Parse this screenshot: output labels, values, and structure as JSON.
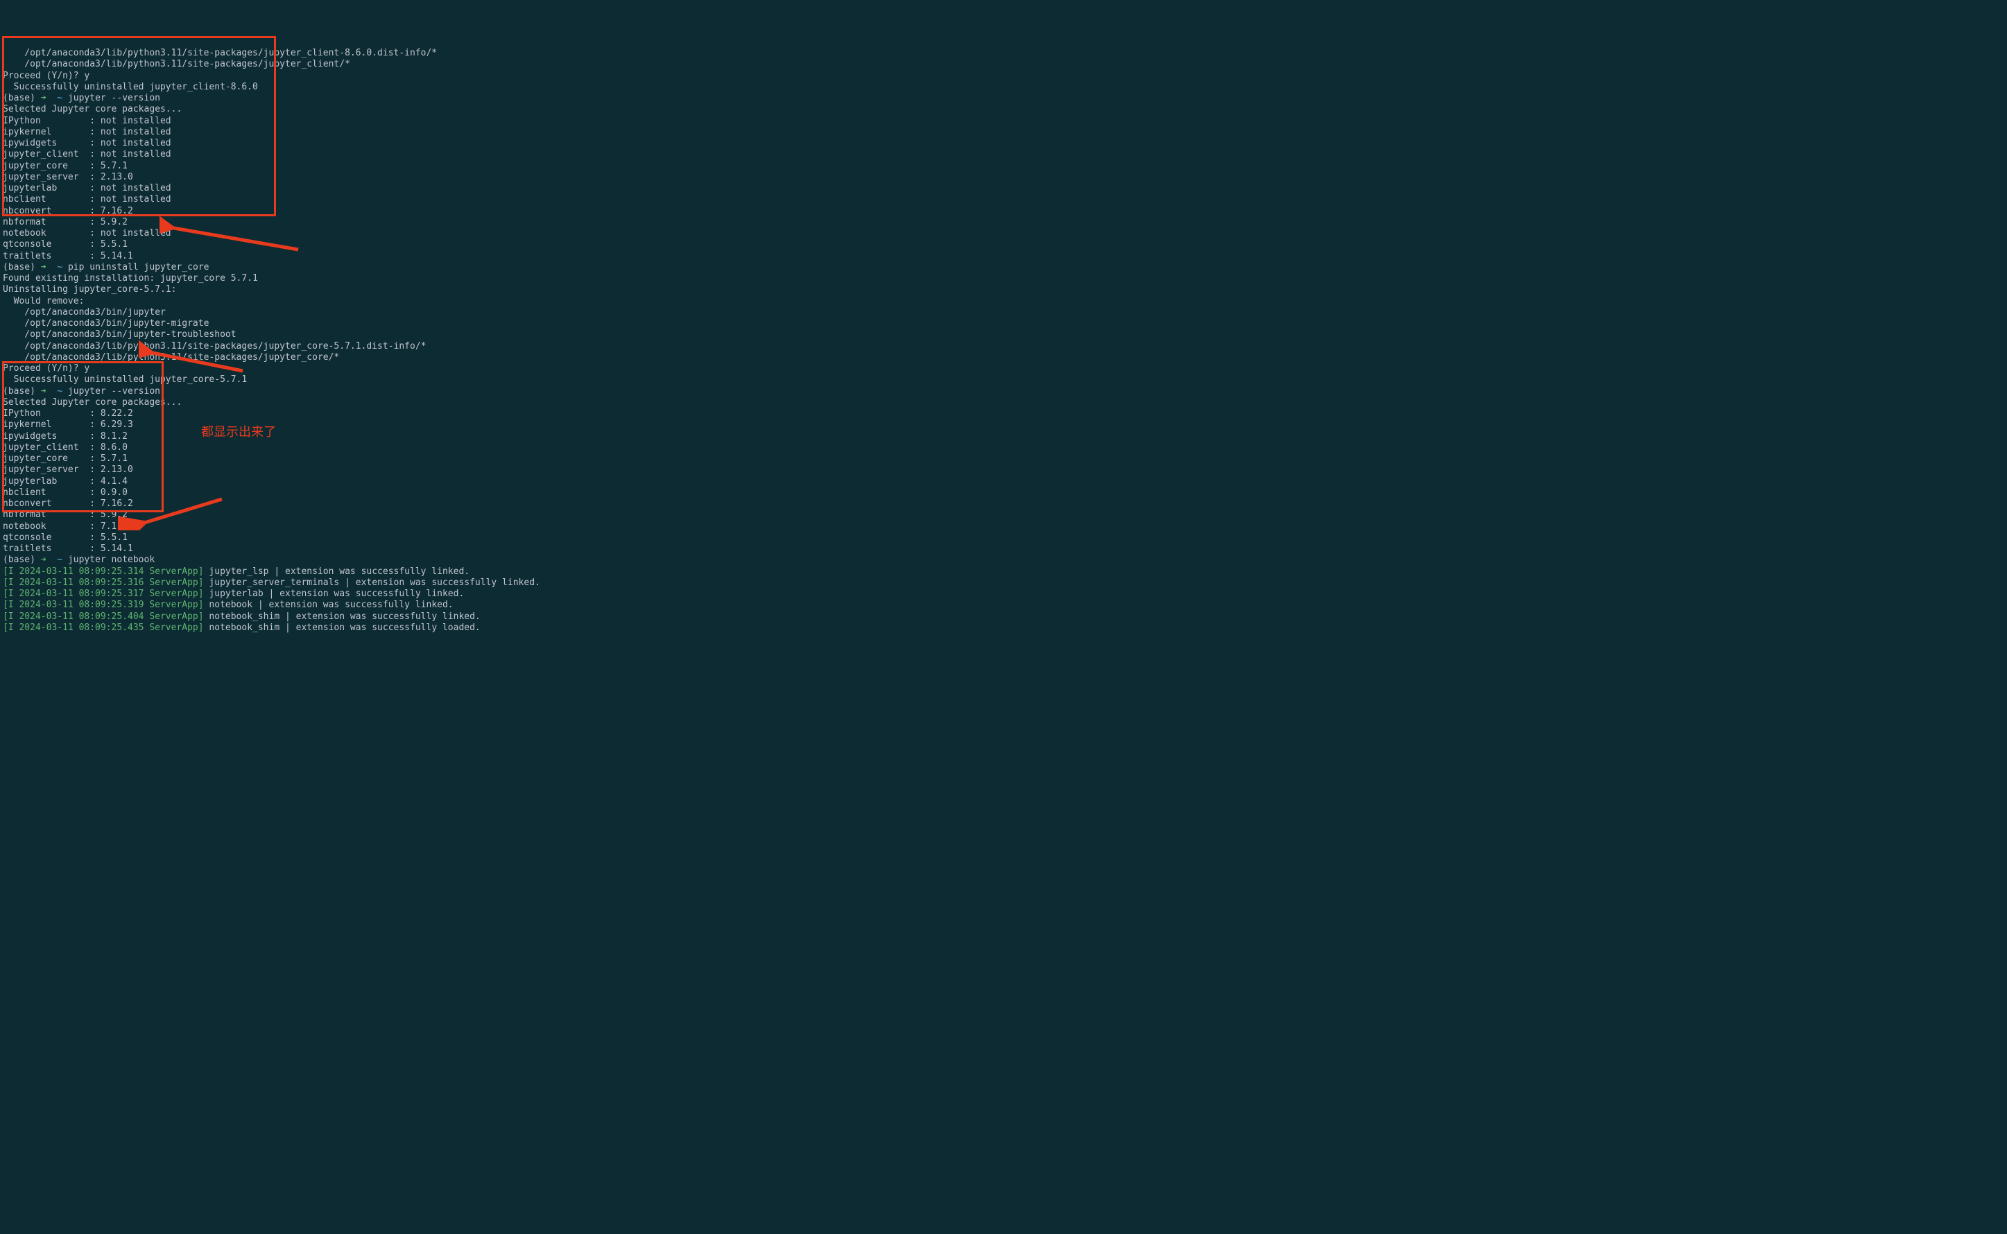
{
  "paths": {
    "p1": "    /opt/anaconda3/lib/python3.11/site-packages/jupyter_client-8.6.0.dist-info/*",
    "p2": "    /opt/anaconda3/lib/python3.11/site-packages/jupyter_client/*"
  },
  "proceed1": "Proceed (Y/n)? y",
  "uninst1": "  Successfully uninstalled jupyter_client-8.6.0",
  "prompt": {
    "base": "(base)",
    "arrow": "➜",
    "tilde": "~"
  },
  "cmd1": "jupyter --version",
  "sel1": "Selected Jupyter core packages...",
  "pkgs1": [
    [
      "IPython",
      ": not installed"
    ],
    [
      "ipykernel",
      ": not installed"
    ],
    [
      "ipywidgets",
      ": not installed"
    ],
    [
      "jupyter_client",
      ": not installed"
    ],
    [
      "jupyter_core",
      ": 5.7.1"
    ],
    [
      "jupyter_server",
      ": 2.13.0"
    ],
    [
      "jupyterlab",
      ": not installed"
    ],
    [
      "nbclient",
      ": not installed"
    ],
    [
      "nbconvert",
      ": 7.16.2"
    ],
    [
      "nbformat",
      ": 5.9.2"
    ],
    [
      "notebook",
      ": not installed"
    ],
    [
      "qtconsole",
      ": 5.5.1"
    ],
    [
      "traitlets",
      ": 5.14.1"
    ]
  ],
  "cmd2": "pip uninstall jupyter_core",
  "found": "Found existing installation: jupyter_core 5.7.1",
  "uninst_hdr": "Uninstalling jupyter_core-5.7.1:",
  "would_remove": "  Would remove:",
  "remove_paths": [
    "    /opt/anaconda3/bin/jupyter",
    "    /opt/anaconda3/bin/jupyter-migrate",
    "    /opt/anaconda3/bin/jupyter-troubleshoot",
    "    /opt/anaconda3/lib/python3.11/site-packages/jupyter_core-5.7.1.dist-info/*",
    "    /opt/anaconda3/lib/python3.11/site-packages/jupyter_core/*"
  ],
  "proceed2": "Proceed (Y/n)? y",
  "uninst2": "  Successfully uninstalled jupyter_core-5.7.1",
  "cmd3": "jupyter --version",
  "sel2": "Selected Jupyter core packages...",
  "pkgs2": [
    [
      "IPython",
      ": 8.22.2"
    ],
    [
      "ipykernel",
      ": 6.29.3"
    ],
    [
      "ipywidgets",
      ": 8.1.2"
    ],
    [
      "jupyter_client",
      ": 8.6.0"
    ],
    [
      "jupyter_core",
      ": 5.7.1"
    ],
    [
      "jupyter_server",
      ": 2.13.0"
    ],
    [
      "jupyterlab",
      ": 4.1.4"
    ],
    [
      "nbclient",
      ": 0.9.0"
    ],
    [
      "nbconvert",
      ": 7.16.2"
    ],
    [
      "nbformat",
      ": 5.9.2"
    ],
    [
      "notebook",
      ": 7.1.1"
    ],
    [
      "qtconsole",
      ": 5.5.1"
    ],
    [
      "traitlets",
      ": 5.14.1"
    ]
  ],
  "cmd4": "jupyter notebook",
  "logs": [
    [
      "[I 2024-03-11 08:09:25.314 ServerApp]",
      " jupyter_lsp | extension was successfully linked."
    ],
    [
      "[I 2024-03-11 08:09:25.316 ServerApp]",
      " jupyter_server_terminals | extension was successfully linked."
    ],
    [
      "[I 2024-03-11 08:09:25.317 ServerApp]",
      " jupyterlab | extension was successfully linked."
    ],
    [
      "[I 2024-03-11 08:09:25.319 ServerApp]",
      " notebook | extension was successfully linked."
    ],
    [
      "[I 2024-03-11 08:09:25.404 ServerApp]",
      " notebook_shim | extension was successfully linked."
    ],
    [
      "[I 2024-03-11 08:09:25.435 ServerApp]",
      " notebook_shim | extension was successfully loaded."
    ]
  ],
  "annotation": "都显示出来了"
}
